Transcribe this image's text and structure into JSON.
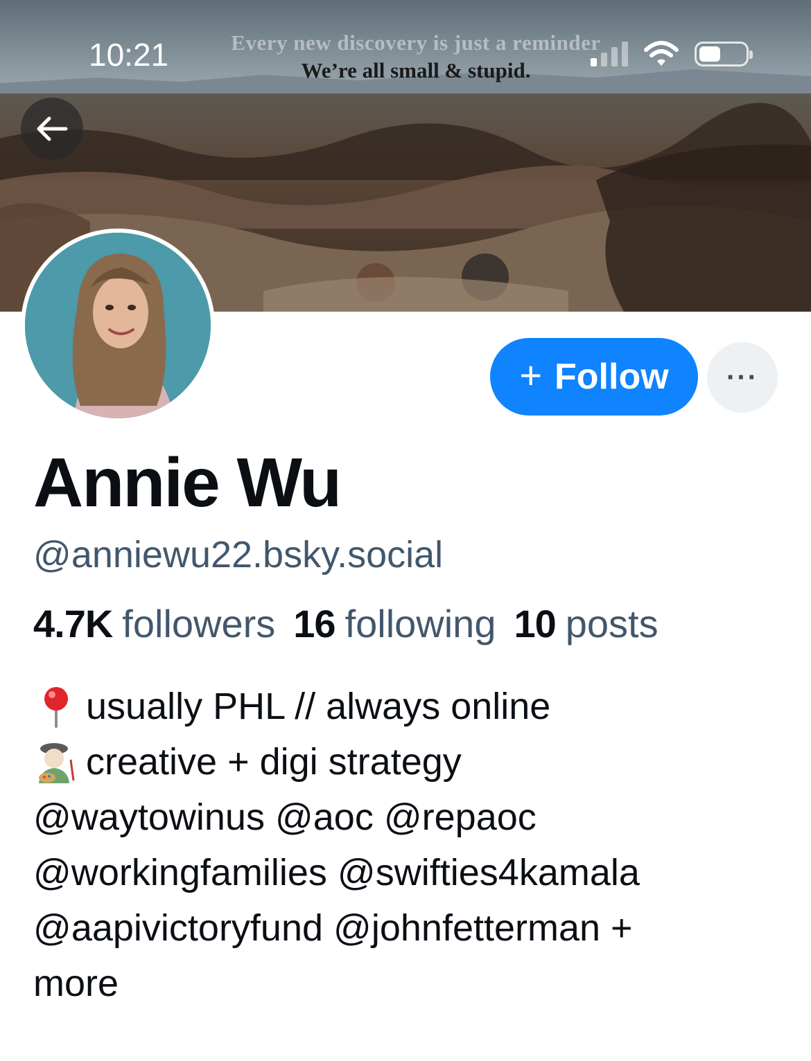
{
  "status_bar": {
    "time": "10:21"
  },
  "banner": {
    "quote_line_1": "Every new discovery is just a reminder",
    "quote_line_2": "We’re all small & stupid."
  },
  "profile": {
    "display_name": "Annie Wu",
    "handle": "@anniewu22.bsky.social",
    "follow_label": "Follow",
    "more_label": "···",
    "stats": {
      "followers_count": "4.7K",
      "followers_label": "followers",
      "following_count": "16",
      "following_label": "following",
      "posts_count": "10",
      "posts_label": "posts"
    },
    "bio": {
      "line_1": "usually PHL // always online",
      "line_2": "creative + digi strategy",
      "line_3": "@waytowinus @aoc @repaoc",
      "line_4": "@workingfamilies @swifties4kamala",
      "line_5": "@aapivictoryfund @johnfetterman +",
      "line_6": "more",
      "icons": [
        "round-pushpin-icon",
        "artist-emoji-icon"
      ]
    }
  },
  "colors": {
    "accent": "#1083fe",
    "secondary_text": "#42576c",
    "primary_text": "#0b0f14",
    "more_button_bg": "#eef1f4"
  }
}
